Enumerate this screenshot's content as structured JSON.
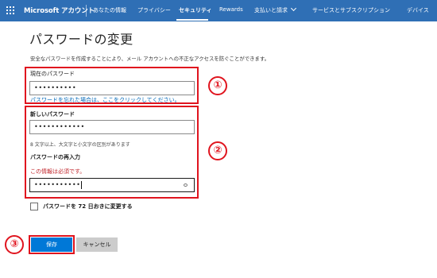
{
  "header": {
    "brand": "Microsoft アカウント",
    "nav": [
      "あなたの情報",
      "プライバシー",
      "セキュリティ",
      "Rewards",
      "支払いと請求",
      "サービスとサブスクリプション",
      "デバイス"
    ],
    "active_nav": "セキュリティ",
    "bar_color": "#2f6fb5"
  },
  "page": {
    "title": "パスワードの変更",
    "intro": "安全なパスワードを作成することにより、メール アカウントへの不正なアクセスを防ぐことができます。"
  },
  "current_password": {
    "label": "現在のパスワード",
    "value": "••••••••••",
    "forgot_link": "パスワードを忘れた場合は、ここをクリックしてください。"
  },
  "new_password": {
    "label": "新しいパスワード",
    "value": "••••••••••••",
    "hint": "8 文字以上、大文字と小文字の区別があります"
  },
  "confirm_password": {
    "label": "パスワードの再入力",
    "error": "この情報は必須です。",
    "value": "•••••••••••"
  },
  "expire_checkbox": {
    "label": "パスワードを 72 日おきに変更する",
    "checked": false
  },
  "actions": {
    "save": "保存",
    "cancel": "キャンセル"
  },
  "callouts": [
    "①",
    "②",
    "③"
  ],
  "colors": {
    "accent": "#0078d7",
    "highlight": "#e0141e",
    "error": "#c1272d",
    "link": "#0067b8"
  }
}
